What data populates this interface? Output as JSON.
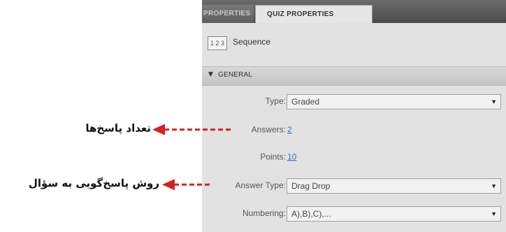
{
  "tabs": {
    "inactive_label": "PROPERTIES",
    "active_label": "QUIZ PROPERTIES"
  },
  "sequence": {
    "icon_text": "1 2 3",
    "label": "Sequence"
  },
  "section": {
    "label": "GENERAL"
  },
  "fields": {
    "type": {
      "label": "Type:",
      "value": "Graded"
    },
    "answers": {
      "label": "Answers:",
      "value": "2"
    },
    "points": {
      "label": "Points:",
      "value": "10"
    },
    "answer_type": {
      "label": "Answer Type:",
      "value": "Drag Drop"
    },
    "numbering": {
      "label": "Numbering:",
      "value": "A),B),C),..."
    }
  },
  "annotations": {
    "answers_count": "تعداد پاسخ‌ها",
    "answer_method": "روش پاسخ‌گویی به سؤال"
  },
  "colors": {
    "annotation_arrow": "#d61f1f",
    "link": "#3f6fb8"
  }
}
